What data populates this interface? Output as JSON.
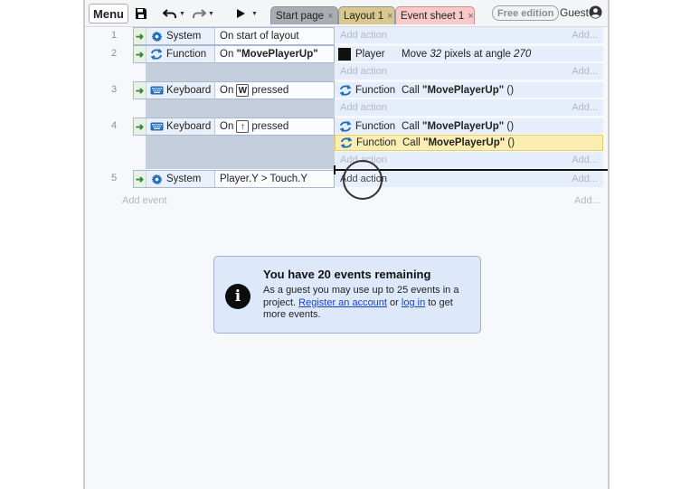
{
  "toolbar": {
    "menu_label": "Menu",
    "save_icon": "save-icon",
    "undo_icon": "undo-icon",
    "redo_icon": "redo-icon",
    "play_icon": "play-icon",
    "tabs": [
      {
        "label": "Start page",
        "close": "×"
      },
      {
        "label": "Layout 1",
        "close": "×"
      },
      {
        "label": "Event sheet 1",
        "close": "×"
      }
    ],
    "edition_badge": "Free edition",
    "user_label": "Guest",
    "user_icon": "user-icon"
  },
  "events": [
    {
      "number": "1",
      "condition": {
        "object": "System",
        "text": "On start of layout"
      },
      "add_action": "Add action",
      "add_right": "Add..."
    },
    {
      "number": "2",
      "condition": {
        "object": "Function",
        "text_prefix": "On ",
        "text_bold": "\"MovePlayerUp\""
      },
      "actions": [
        {
          "object": "Player",
          "text_pre": "Move ",
          "text_em1": "32",
          "text_mid": " pixels at angle ",
          "text_em2": "270"
        }
      ],
      "add_action": "Add action",
      "add_right": "Add..."
    },
    {
      "number": "3",
      "condition": {
        "object": "Keyboard",
        "text_prefix": "On",
        "key": "W",
        "text_suffix": "pressed"
      },
      "actions": [
        {
          "object": "Function",
          "text_pre": "Call ",
          "text_bold": "\"MovePlayerUp\"",
          "text_post": " ()"
        }
      ],
      "add_action": "Add action",
      "add_right": "Add..."
    },
    {
      "number": "4",
      "condition": {
        "object": "Keyboard",
        "text_prefix": "On",
        "key": "↑",
        "text_suffix": "pressed"
      },
      "actions": [
        {
          "object": "Function",
          "text_pre": "Call ",
          "text_bold": "\"MovePlayerUp\"",
          "text_post": " ()"
        },
        {
          "object": "Function",
          "text_pre": "Call ",
          "text_bold": "\"MovePlayerUp\"",
          "text_post": " ()"
        }
      ],
      "add_action": "Add action",
      "add_right": "Add..."
    },
    {
      "number": "5",
      "condition": {
        "object": "System",
        "text": "Player.Y > Touch.Y"
      },
      "add_action": "Add action",
      "add_right": "Add..."
    }
  ],
  "add_event": {
    "label": "Add event",
    "right": "Add..."
  },
  "info": {
    "title": "You have 20 events remaining",
    "body_1": "As a guest you may use up to 25 events in a project. ",
    "link_register": "Register an account",
    "body_2": " or ",
    "link_login": "log in",
    "body_3": " to get more events."
  },
  "colors": {
    "accent_link": "#1a3fd6",
    "highlight_action": "#fbeeb3",
    "tab_event_sheet": "#f7c9c9",
    "tab_layout": "#d8c88e"
  }
}
